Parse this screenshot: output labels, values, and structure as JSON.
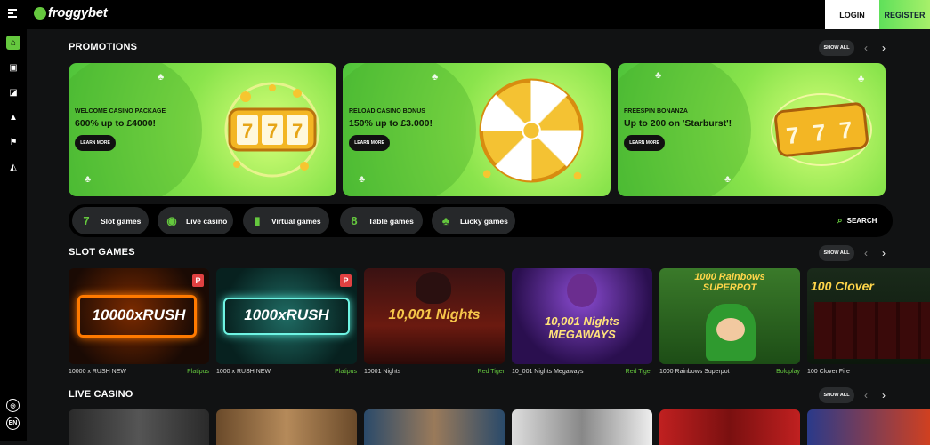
{
  "header": {
    "brand": "froggybet",
    "login_label": "LOGIN",
    "register_label": "REGISTER"
  },
  "sidebar": {
    "icons": [
      "home-icon",
      "casino-icon",
      "sports-icon",
      "virtual-icon",
      "flag-icon",
      "megaphone-icon"
    ],
    "language": "EN"
  },
  "promotions": {
    "title": "PROMOTIONS",
    "show_all": "SHOW ALL",
    "cards": [
      {
        "subtitle": "WELCOME CASINO PACKAGE",
        "headline": "600% up to £4000!",
        "button": "LEARN MORE"
      },
      {
        "subtitle": "RELOAD CASINO BONUS",
        "headline": "150% up to £3.000!",
        "button": "LEARN MORE"
      },
      {
        "subtitle": "FREESPIN BONANZA",
        "headline": "Up to 200 on 'Starburst'!",
        "button": "LEARN MORE"
      }
    ]
  },
  "categories": {
    "items": [
      {
        "label": "Slot games",
        "icon": "7"
      },
      {
        "label": "Live casino",
        "icon": "◉"
      },
      {
        "label": "Virtual games",
        "icon": "▮"
      },
      {
        "label": "Table games",
        "icon": "8"
      },
      {
        "label": "Lucky games",
        "icon": "♣"
      }
    ],
    "search_label": "SEARCH"
  },
  "slot_games": {
    "title": "SLOT GAMES",
    "show_all": "SHOW ALL",
    "games": [
      {
        "art_text": "10000xRUSH",
        "badge": "P",
        "name": "10000 x RUSH NEW",
        "provider": "Platipus"
      },
      {
        "art_text": "1000xRUSH",
        "badge": "P",
        "name": "1000 x RUSH NEW",
        "provider": "Platipus"
      },
      {
        "art_text": "10,001 Nights",
        "badge": "",
        "name": "10001 Nights",
        "provider": "Red Tiger"
      },
      {
        "art_text": "10,001 Nights MEGAWAYS",
        "badge": "",
        "name": "10_001 Nights Megaways",
        "provider": "Red Tiger"
      },
      {
        "art_text": "1000 Rainbows SUPERPOT",
        "badge": "",
        "name": "1000 Rainbows Superpot",
        "provider": "Boldplay"
      },
      {
        "art_text": "100 Clover",
        "badge": "",
        "name": "100 Clover Fire",
        "provider": ""
      }
    ]
  },
  "live_casino": {
    "title": "LIVE CASINO",
    "show_all": "SHOW ALL"
  },
  "colors": {
    "accent": "#65c83e",
    "background": "#111213",
    "bar": "#000000"
  }
}
